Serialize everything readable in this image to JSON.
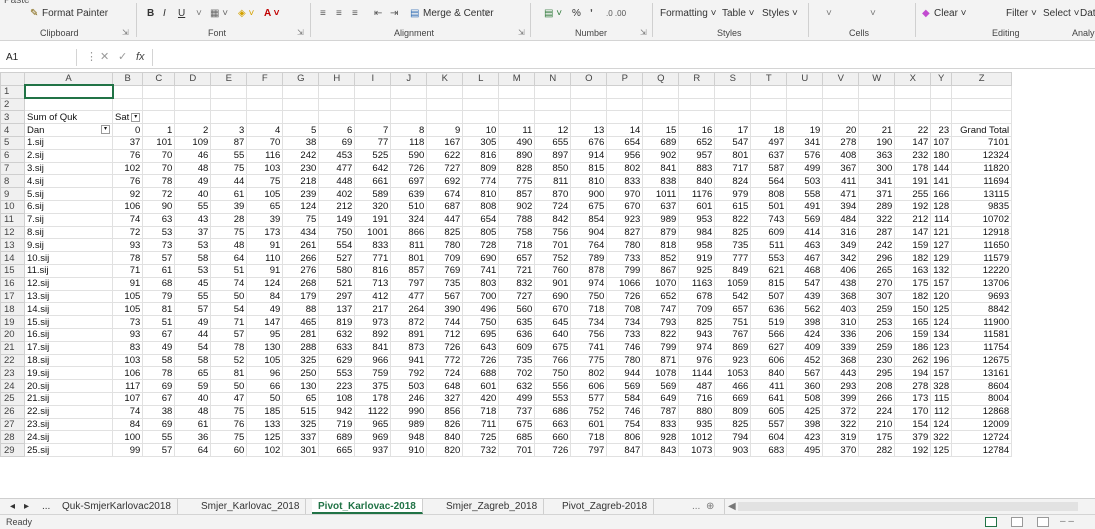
{
  "ribbon": {
    "format_painter": "Format Painter",
    "bold": "B",
    "italic": "I",
    "underline": "U",
    "merge_center": "Merge & Center",
    "percent": "%",
    "comma": "ʼ",
    "cond_formatting": "Formatting ˅",
    "table": "Table ˅",
    "styles": "Styles ˅",
    "clear": "Clear ˅",
    "filter": "Filter ˅",
    "select": "Select ˅",
    "dat": "Dat",
    "groups": {
      "clipboard": "Clipboard",
      "font": "Font",
      "alignment": "Alignment",
      "number": "Number",
      "styles": "Styles",
      "cells": "Cells",
      "editing": "Editing",
      "analysis": "Analy"
    }
  },
  "formula_bar": {
    "name_box": "A1",
    "cancel": "✕",
    "enter": "✓",
    "fx": "fx",
    "value": ""
  },
  "columns": [
    "A",
    "B",
    "C",
    "D",
    "E",
    "F",
    "G",
    "H",
    "I",
    "J",
    "K",
    "L",
    "M",
    "N",
    "O",
    "P",
    "Q",
    "R",
    "S",
    "T",
    "U",
    "V",
    "W",
    "X",
    "Y",
    "Z"
  ],
  "pivot": {
    "sum_label": "Sum of Quk",
    "col_field": "Sat",
    "row_field": "Dan",
    "hours": [
      "0",
      "1",
      "2",
      "3",
      "4",
      "5",
      "6",
      "7",
      "8",
      "9",
      "10",
      "11",
      "12",
      "13",
      "14",
      "15",
      "16",
      "17",
      "18",
      "19",
      "20",
      "21",
      "22",
      "23"
    ],
    "grand_total": "Grand Total",
    "rows": [
      {
        "label": "1.sij",
        "v": [
          37,
          101,
          109,
          87,
          70,
          38,
          69,
          77,
          118,
          167,
          305,
          490,
          655,
          676,
          654,
          689,
          652,
          547,
          497,
          341,
          278,
          190,
          147,
          107
        ],
        "t": 7101
      },
      {
        "label": "2.sij",
        "v": [
          76,
          70,
          46,
          55,
          116,
          242,
          453,
          525,
          590,
          622,
          816,
          890,
          897,
          914,
          956,
          902,
          957,
          801,
          637,
          576,
          408,
          363,
          232,
          180
        ],
        "t": 12324
      },
      {
        "label": "3.sij",
        "v": [
          102,
          70,
          48,
          75,
          103,
          230,
          477,
          642,
          726,
          727,
          809,
          828,
          850,
          815,
          802,
          841,
          883,
          717,
          587,
          499,
          367,
          300,
          178,
          144
        ],
        "t": 11820
      },
      {
        "label": "4.sij",
        "v": [
          76,
          78,
          49,
          44,
          75,
          218,
          448,
          661,
          697,
          692,
          774,
          775,
          811,
          810,
          833,
          838,
          840,
          824,
          564,
          503,
          411,
          341,
          191,
          141
        ],
        "t": 11694
      },
      {
        "label": "5.sij",
        "v": [
          92,
          72,
          40,
          61,
          105,
          239,
          402,
          589,
          639,
          674,
          810,
          857,
          870,
          900,
          970,
          1011,
          1176,
          979,
          808,
          558,
          471,
          371,
          255,
          166
        ],
        "t": 13115
      },
      {
        "label": "6.sij",
        "v": [
          106,
          90,
          55,
          39,
          65,
          124,
          212,
          320,
          510,
          687,
          808,
          902,
          724,
          675,
          670,
          637,
          601,
          615,
          501,
          491,
          394,
          289,
          192,
          128
        ],
        "t": 9835
      },
      {
        "label": "7.sij",
        "v": [
          74,
          63,
          43,
          28,
          39,
          75,
          149,
          191,
          324,
          447,
          654,
          788,
          842,
          854,
          923,
          989,
          953,
          822,
          743,
          569,
          484,
          322,
          212,
          114
        ],
        "t": 10702
      },
      {
        "label": "8.sij",
        "v": [
          72,
          53,
          37,
          75,
          173,
          434,
          750,
          1001,
          866,
          825,
          805,
          758,
          756,
          904,
          827,
          879,
          984,
          825,
          609,
          414,
          316,
          287,
          147,
          121
        ],
        "t": 12918
      },
      {
        "label": "9.sij",
        "v": [
          93,
          73,
          53,
          48,
          91,
          261,
          554,
          833,
          811,
          780,
          728,
          718,
          701,
          764,
          780,
          818,
          958,
          735,
          511,
          463,
          349,
          242,
          159,
          127
        ],
        "t": 11650
      },
      {
        "label": "10.sij",
        "v": [
          78,
          57,
          58,
          64,
          110,
          266,
          527,
          771,
          801,
          709,
          690,
          657,
          752,
          789,
          733,
          852,
          919,
          777,
          553,
          467,
          342,
          296,
          182,
          129
        ],
        "t": 11579
      },
      {
        "label": "11.sij",
        "v": [
          71,
          61,
          53,
          51,
          91,
          276,
          580,
          816,
          857,
          769,
          741,
          721,
          760,
          878,
          799,
          867,
          925,
          849,
          621,
          468,
          406,
          265,
          163,
          132
        ],
        "t": 12220
      },
      {
        "label": "12.sij",
        "v": [
          91,
          68,
          45,
          74,
          124,
          268,
          521,
          713,
          797,
          735,
          803,
          832,
          901,
          974,
          1066,
          1070,
          1163,
          1059,
          815,
          547,
          438,
          270,
          175,
          157
        ],
        "t": 13706
      },
      {
        "label": "13.sij",
        "v": [
          105,
          79,
          55,
          50,
          84,
          179,
          297,
          412,
          477,
          567,
          700,
          727,
          690,
          750,
          726,
          652,
          678,
          542,
          507,
          439,
          368,
          307,
          182,
          120
        ],
        "t": 9693
      },
      {
        "label": "14.sij",
        "v": [
          105,
          81,
          57,
          54,
          49,
          88,
          137,
          217,
          264,
          390,
          496,
          560,
          670,
          718,
          708,
          747,
          709,
          657,
          636,
          562,
          403,
          259,
          150,
          125
        ],
        "t": 8842
      },
      {
        "label": "15.sij",
        "v": [
          73,
          51,
          49,
          71,
          147,
          465,
          819,
          973,
          872,
          744,
          750,
          635,
          645,
          734,
          734,
          793,
          825,
          751,
          519,
          398,
          310,
          253,
          165,
          124
        ],
        "t": 11900
      },
      {
        "label": "16.sij",
        "v": [
          93,
          67,
          44,
          57,
          95,
          281,
          632,
          892,
          891,
          712,
          695,
          636,
          640,
          756,
          733,
          822,
          943,
          767,
          566,
          424,
          336,
          206,
          159,
          134
        ],
        "t": 11581
      },
      {
        "label": "17.sij",
        "v": [
          83,
          49,
          54,
          78,
          130,
          288,
          633,
          841,
          873,
          726,
          643,
          609,
          675,
          741,
          746,
          799,
          974,
          869,
          627,
          409,
          339,
          259,
          186,
          123
        ],
        "t": 11754
      },
      {
        "label": "18.sij",
        "v": [
          103,
          58,
          58,
          52,
          105,
          325,
          629,
          966,
          941,
          772,
          726,
          735,
          766,
          775,
          780,
          871,
          976,
          923,
          606,
          452,
          368,
          230,
          262,
          196
        ],
        "t": 12675
      },
      {
        "label": "19.sij",
        "v": [
          106,
          78,
          65,
          81,
          96,
          250,
          553,
          759,
          792,
          724,
          688,
          702,
          750,
          802,
          944,
          1078,
          1144,
          1053,
          840,
          567,
          443,
          295,
          194,
          157
        ],
        "t": 13161
      },
      {
        "label": "20.sij",
        "v": [
          117,
          69,
          59,
          50,
          66,
          130,
          223,
          375,
          503,
          648,
          601,
          632,
          556,
          606,
          569,
          569,
          487,
          466,
          411,
          360,
          293,
          208,
          278,
          328
        ],
        "t": 8604
      },
      {
        "label": "21.sij",
        "v": [
          107,
          67,
          40,
          47,
          50,
          65,
          108,
          178,
          246,
          327,
          420,
          499,
          553,
          577,
          584,
          649,
          716,
          669,
          641,
          508,
          399,
          266,
          173,
          115
        ],
        "t": 8004
      },
      {
        "label": "22.sij",
        "v": [
          74,
          38,
          48,
          75,
          185,
          515,
          942,
          1122,
          990,
          856,
          718,
          737,
          686,
          752,
          746,
          787,
          880,
          809,
          605,
          425,
          372,
          224,
          170,
          112
        ],
        "t": 12868
      },
      {
        "label": "23.sij",
        "v": [
          84,
          69,
          61,
          76,
          133,
          325,
          719,
          965,
          989,
          826,
          711,
          675,
          663,
          601,
          754,
          833,
          935,
          825,
          557,
          398,
          322,
          210,
          154,
          124
        ],
        "t": 12009
      },
      {
        "label": "24.sij",
        "v": [
          100,
          55,
          36,
          75,
          125,
          337,
          689,
          969,
          948,
          840,
          725,
          685,
          660,
          718,
          806,
          928,
          1012,
          794,
          604,
          423,
          319,
          175,
          379,
          322
        ],
        "t": 12724
      },
      {
        "label": "25.sij",
        "v": [
          99,
          57,
          64,
          60,
          102,
          301,
          665,
          937,
          910,
          820,
          732,
          701,
          726,
          797,
          847,
          843,
          1073,
          903,
          683,
          495,
          370,
          282,
          192,
          125
        ],
        "t": 12784
      }
    ]
  },
  "tabs": {
    "nav_prev": "◂",
    "nav_next": "▸",
    "more_left": "...",
    "items": [
      "Quk-SmjerKarlovac2018",
      "Smjer_Karlovac_2018",
      "Pivot_Karlovac-2018",
      "Smjer_Zagreb_2018",
      "Pivot_Zagreb-2018"
    ],
    "active_index": 2,
    "more_right": "...",
    "add": "⊕"
  },
  "status": {
    "text": "Ready"
  }
}
